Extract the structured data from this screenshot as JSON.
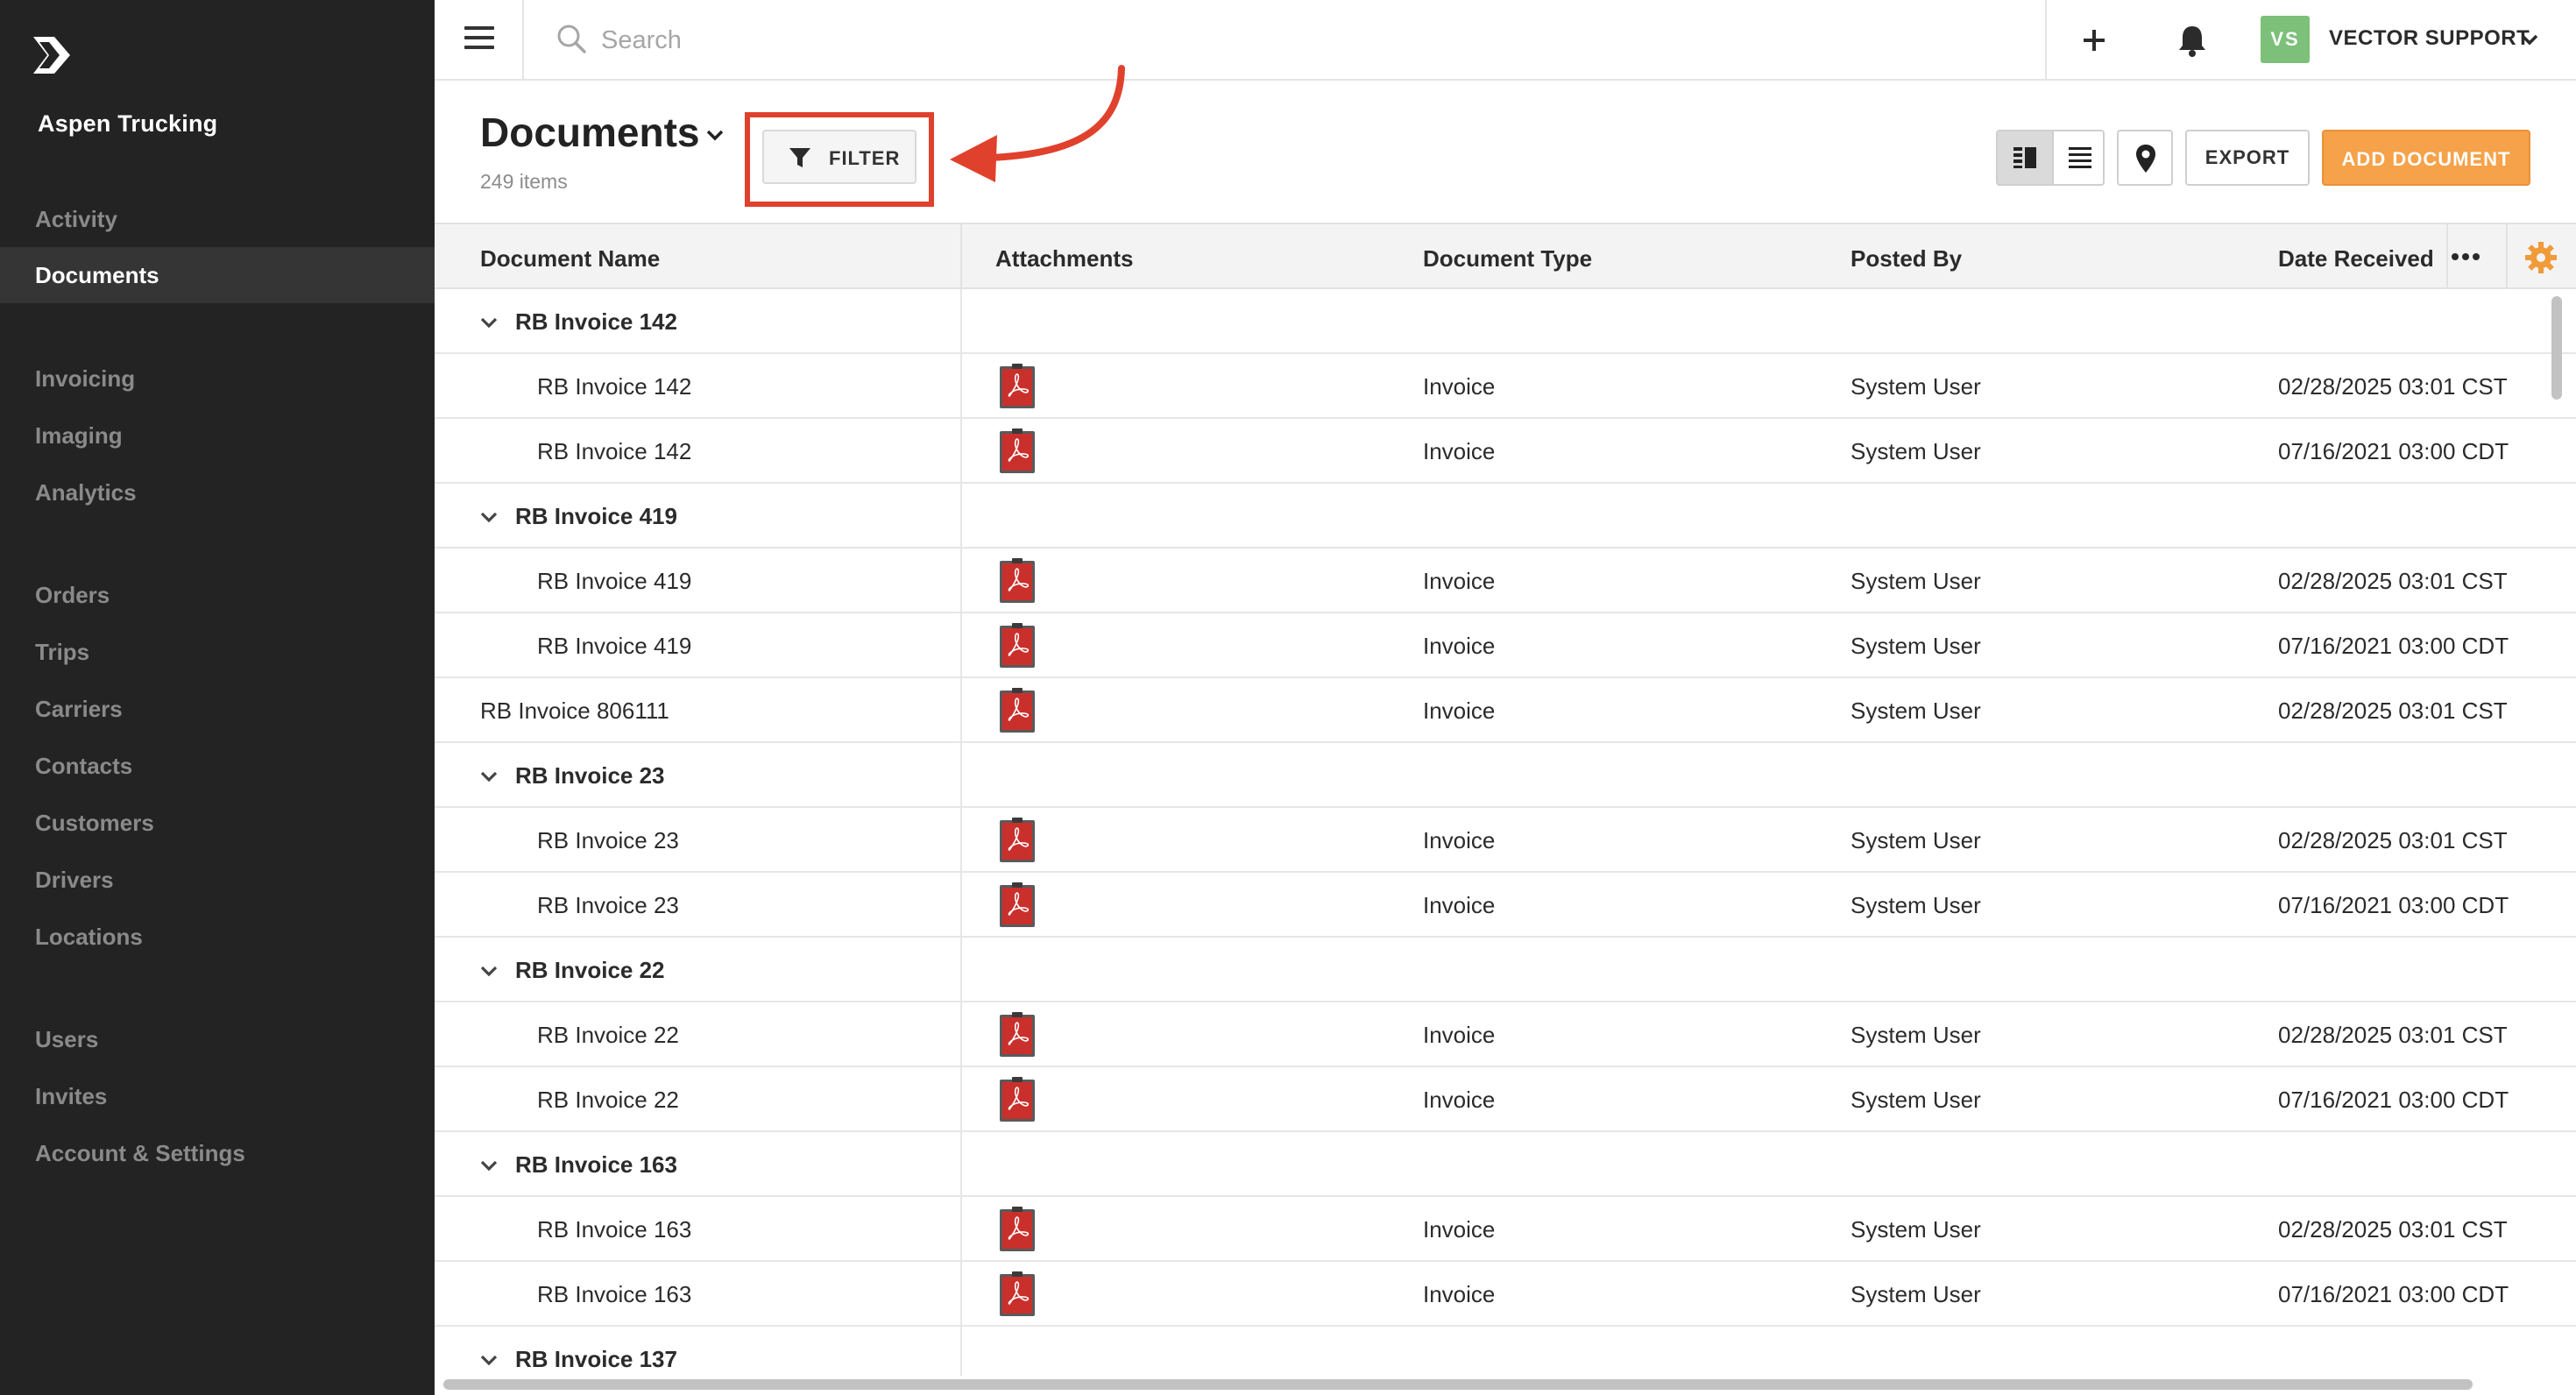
{
  "sidebar": {
    "company": "Aspen Trucking",
    "items": [
      {
        "label": "Activity",
        "active": false
      },
      {
        "label": "Documents",
        "active": true
      },
      {
        "label": "Invoicing",
        "active": false
      },
      {
        "label": "Imaging",
        "active": false
      },
      {
        "label": "Analytics",
        "active": false
      },
      {
        "label": "Orders",
        "active": false
      },
      {
        "label": "Trips",
        "active": false
      },
      {
        "label": "Carriers",
        "active": false
      },
      {
        "label": "Contacts",
        "active": false
      },
      {
        "label": "Customers",
        "active": false
      },
      {
        "label": "Drivers",
        "active": false
      },
      {
        "label": "Locations",
        "active": false
      },
      {
        "label": "Users",
        "active": false
      },
      {
        "label": "Invites",
        "active": false
      },
      {
        "label": "Account & Settings",
        "active": false
      }
    ]
  },
  "topbar": {
    "search_placeholder": "Search",
    "avatar_initials": "VS",
    "user_name": "VECTOR SUPPORT"
  },
  "header": {
    "title": "Documents",
    "count": "249 items",
    "filter_label": "FILTER",
    "export_label": "EXPORT",
    "add_label": "ADD DOCUMENT"
  },
  "table": {
    "columns": [
      "Document Name",
      "Attachments",
      "Document Type",
      "Posted By",
      "Date Received"
    ],
    "rows": [
      {
        "kind": "group",
        "name": "RB Invoice 142"
      },
      {
        "kind": "child",
        "name": "RB Invoice 142",
        "type": "Invoice",
        "posted": "System User",
        "date": "02/28/2025 03:01 CST"
      },
      {
        "kind": "child",
        "name": "RB Invoice 142",
        "type": "Invoice",
        "posted": "System User",
        "date": "07/16/2021 03:00 CDT"
      },
      {
        "kind": "group",
        "name": "RB Invoice 419"
      },
      {
        "kind": "child",
        "name": "RB Invoice 419",
        "type": "Invoice",
        "posted": "System User",
        "date": "02/28/2025 03:01 CST"
      },
      {
        "kind": "child",
        "name": "RB Invoice 419",
        "type": "Invoice",
        "posted": "System User",
        "date": "07/16/2021 03:00 CDT"
      },
      {
        "kind": "flat",
        "name": "RB Invoice 806111",
        "type": "Invoice",
        "posted": "System User",
        "date": "02/28/2025 03:01 CST"
      },
      {
        "kind": "group",
        "name": "RB Invoice 23"
      },
      {
        "kind": "child",
        "name": "RB Invoice 23",
        "type": "Invoice",
        "posted": "System User",
        "date": "02/28/2025 03:01 CST"
      },
      {
        "kind": "child",
        "name": "RB Invoice 23",
        "type": "Invoice",
        "posted": "System User",
        "date": "07/16/2021 03:00 CDT"
      },
      {
        "kind": "group",
        "name": "RB Invoice 22"
      },
      {
        "kind": "child",
        "name": "RB Invoice 22",
        "type": "Invoice",
        "posted": "System User",
        "date": "02/28/2025 03:01 CST"
      },
      {
        "kind": "child",
        "name": "RB Invoice 22",
        "type": "Invoice",
        "posted": "System User",
        "date": "07/16/2021 03:00 CDT"
      },
      {
        "kind": "group",
        "name": "RB Invoice 163"
      },
      {
        "kind": "child",
        "name": "RB Invoice 163",
        "type": "Invoice",
        "posted": "System User",
        "date": "02/28/2025 03:01 CST"
      },
      {
        "kind": "child",
        "name": "RB Invoice 163",
        "type": "Invoice",
        "posted": "System User",
        "date": "07/16/2021 03:00 CDT"
      },
      {
        "kind": "group",
        "name": "RB Invoice 137"
      }
    ]
  },
  "colors": {
    "sidebar_bg": "#232323",
    "accent_orange": "#f5a24a",
    "highlight_red": "#e0412d",
    "avatar_green": "#7cc07a",
    "pdf_red": "#c9302c"
  }
}
